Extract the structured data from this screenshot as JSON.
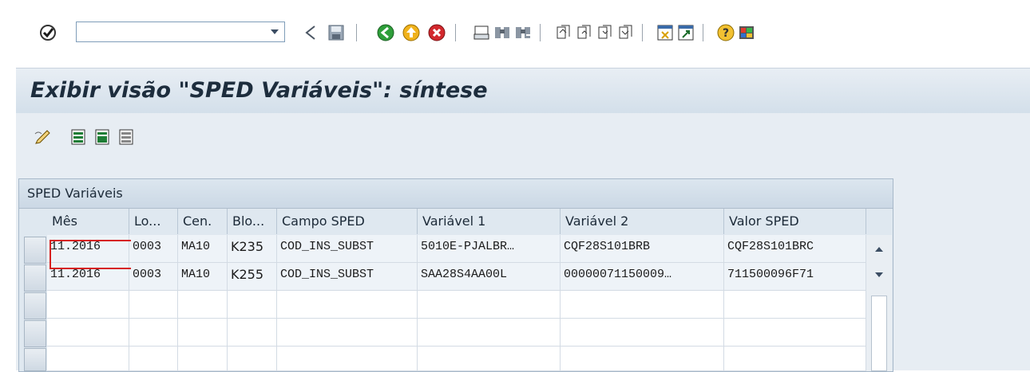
{
  "toolbar": {
    "command_field_value": "",
    "icons": [
      "enter-icon",
      "dropdown-icon",
      "back-triangle-icon",
      "save-icon",
      "back-icon",
      "exit-icon",
      "cancel-icon",
      "print-icon",
      "find-icon",
      "find-next-icon",
      "first-page-icon",
      "previous-page-icon",
      "next-page-icon",
      "last-page-icon",
      "create-session-icon",
      "shortcut-icon",
      "help-icon",
      "layout-icon"
    ]
  },
  "title": "Exibir visão \"SPED Variáveis\": síntese",
  "app_toolbar": {
    "icons": [
      "change-display-icon",
      "select-all-icon",
      "select-block-icon",
      "deselect-all-icon"
    ]
  },
  "table": {
    "title": "SPED Variáveis",
    "columns": [
      "Mês",
      "Lo...",
      "Cen.",
      "Blo...",
      "Campo SPED",
      "Variável 1",
      "Variável 2",
      "Valor SPED"
    ],
    "rows": [
      [
        "11.2016",
        "0003",
        "MA10",
        "K235",
        "COD_INS_SUBST",
        "5010E-PJALBR…",
        "CQF28S101BRB",
        "CQF28S101BRC"
      ],
      [
        "11.2016",
        "0003",
        "MA10",
        "K255",
        "COD_INS_SUBST",
        "SAA28S4AA00L",
        "00000071150009…",
        "711500096F71"
      ]
    ]
  },
  "colors": {
    "accent_title_bg": "#d3dfea",
    "cursor": "#d61f1f"
  }
}
